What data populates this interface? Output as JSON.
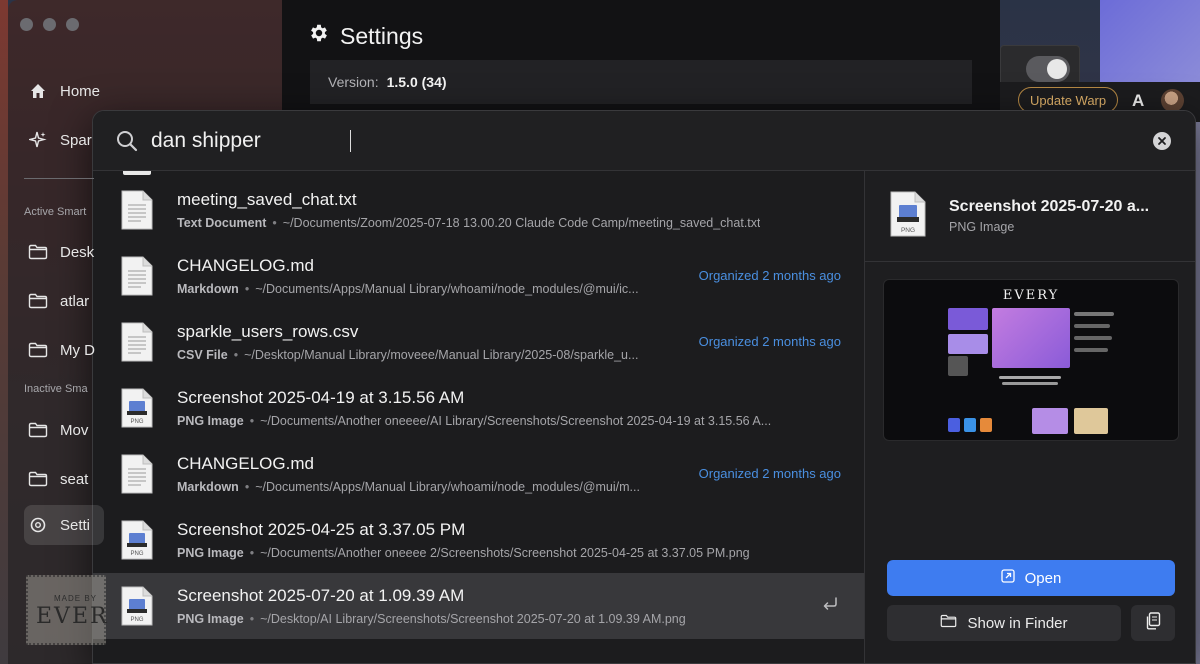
{
  "sidebar": {
    "items": [
      {
        "label": "Home",
        "icon": "house-icon"
      },
      {
        "label": "Spar",
        "icon": "sparkle-icon"
      },
      {
        "label": "Desk",
        "icon": "folder-icon"
      },
      {
        "label": "atlar",
        "icon": "folder-icon"
      },
      {
        "label": "My D",
        "icon": "folder-icon"
      },
      {
        "label": "Mov",
        "icon": "folder-icon"
      },
      {
        "label": "seat",
        "icon": "folder-icon"
      },
      {
        "label": "Setti",
        "icon": "gear-icon"
      }
    ],
    "section_active": "Active Smart",
    "section_inactive": "Inactive Sma",
    "made_by_label": "MADE BY",
    "made_by_logo": "EVER"
  },
  "settings": {
    "title": "Settings",
    "version_label": "Version:",
    "version_value": "1.5.0 (34)"
  },
  "warp": {
    "update_label": "Update Warp",
    "logo": "A"
  },
  "search": {
    "query": "dan shipper"
  },
  "results": [
    {
      "name": "meeting_saved_chat.txt",
      "type": "Text Document",
      "path": "~/Documents/Zoom/2025-07-18 13.00.20 Claude Code Camp/meeting_saved_chat.txt",
      "tag": "",
      "icon": "document-icon"
    },
    {
      "name": "CHANGELOG.md",
      "type": "Markdown",
      "path": "~/Documents/Apps/Manual Library/whoami/node_modules/@mui/ic...",
      "tag": "Organized 2 months ago",
      "icon": "document-icon"
    },
    {
      "name": "sparkle_users_rows.csv",
      "type": "CSV File",
      "path": "~/Desktop/Manual Library/moveee/Manual Library/2025-08/sparkle_u...",
      "tag": "Organized 2 months ago",
      "icon": "document-icon"
    },
    {
      "name": "Screenshot 2025-04-19 at 3.15.56 AM",
      "type": "PNG Image",
      "path": "~/Documents/Another oneeee/AI Library/Screenshots/Screenshot 2025-04-19 at 3.15.56 A...",
      "tag": "",
      "icon": "png-file-icon"
    },
    {
      "name": "CHANGELOG.md",
      "type": "Markdown",
      "path": "~/Documents/Apps/Manual Library/whoami/node_modules/@mui/m...",
      "tag": "Organized 2 months ago",
      "icon": "document-icon"
    },
    {
      "name": "Screenshot 2025-04-25 at 3.37.05 PM",
      "type": "PNG Image",
      "path": "~/Documents/Another oneeee 2/Screenshots/Screenshot 2025-04-25 at 3.37.05 PM.png",
      "tag": "",
      "icon": "png-file-icon"
    },
    {
      "name": "Screenshot 2025-07-20 at 1.09.39 AM",
      "type": "PNG Image",
      "path": "~/Desktop/AI Library/Screenshots/Screenshot 2025-07-20 at 1.09.39 AM.png",
      "tag": "",
      "icon": "png-file-icon",
      "selected": true
    }
  ],
  "preview": {
    "title": "Screenshot 2025-07-20 a...",
    "subtitle": "PNG Image",
    "icon_label": "PNG",
    "thumb_logo": "EVERY",
    "open_label": "Open",
    "finder_label": "Show in Finder"
  },
  "colors": {
    "accent": "#3e7cf0",
    "tag": "#4a8fe0",
    "update": "#e3b46b"
  }
}
